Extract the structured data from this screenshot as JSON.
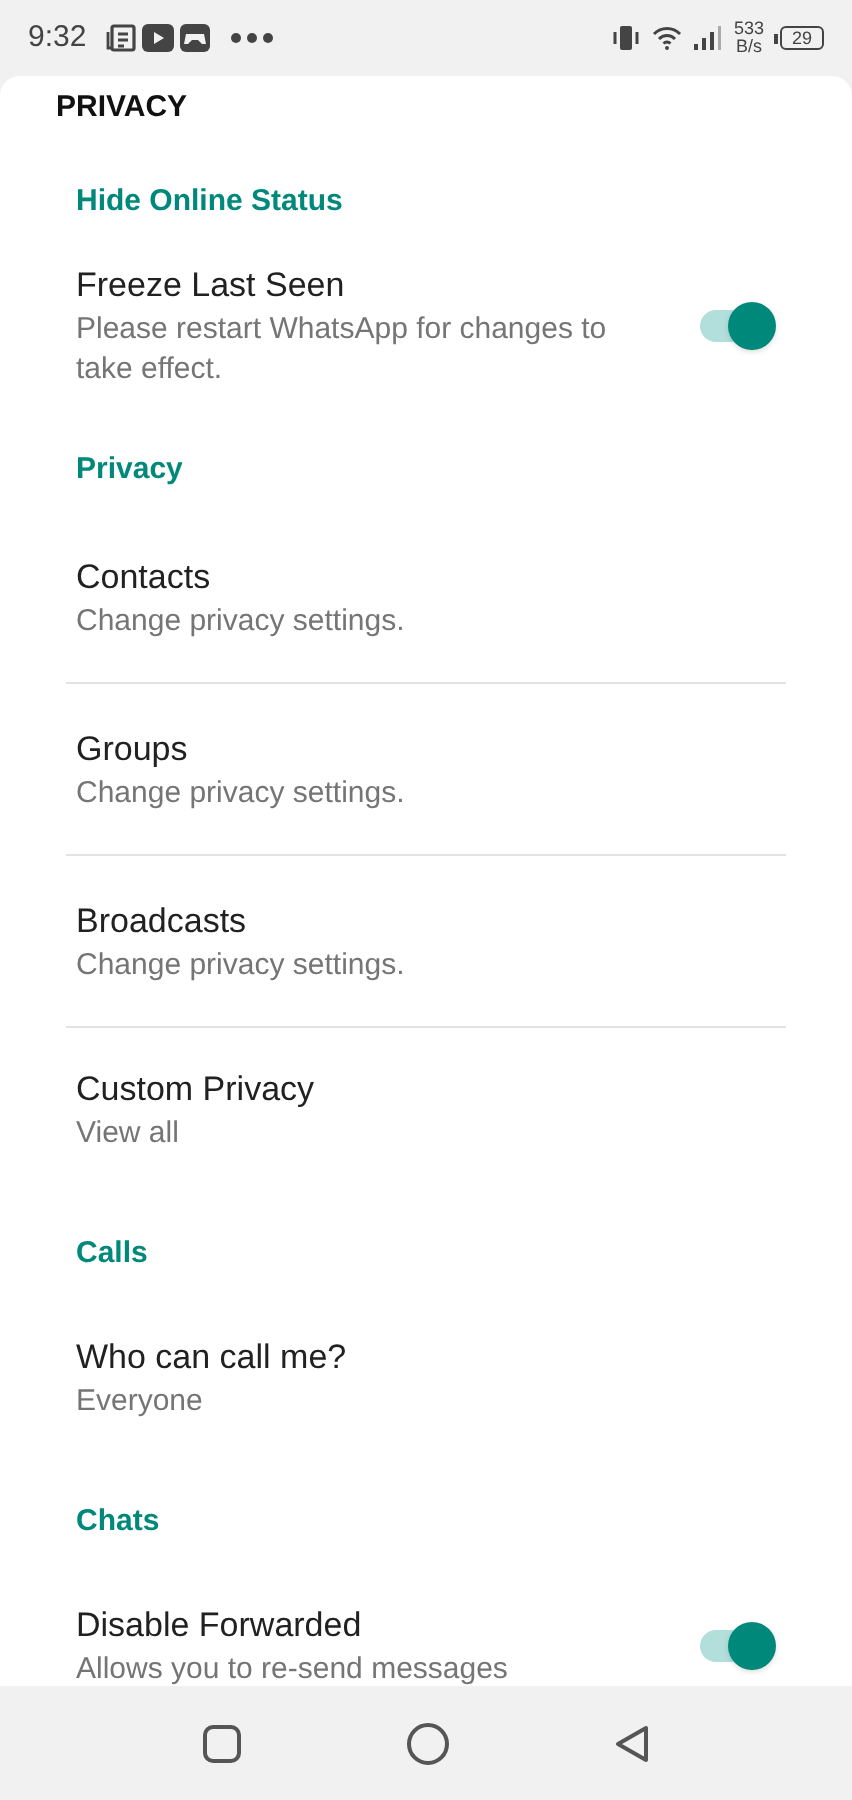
{
  "status_bar": {
    "time": "9:32",
    "speed_value": "533",
    "speed_unit": "B/s",
    "battery": "29"
  },
  "title": "PRIVACY",
  "sections": [
    {
      "title": "Hide Online Status",
      "items": [
        {
          "kind": "switch",
          "title": "Freeze Last Seen",
          "subtitle": "Please restart WhatsApp for changes to take effect.",
          "on": true
        }
      ]
    },
    {
      "title": "Privacy",
      "items": [
        {
          "kind": "item",
          "title": "Contacts",
          "subtitle": "Change privacy settings."
        },
        {
          "kind": "item",
          "title": "Groups",
          "subtitle": "Change privacy settings."
        },
        {
          "kind": "item",
          "title": "Broadcasts",
          "subtitle": "Change privacy settings."
        },
        {
          "kind": "item",
          "title": "Custom Privacy",
          "subtitle": "View all"
        }
      ]
    },
    {
      "title": "Calls",
      "items": [
        {
          "kind": "item",
          "title": "Who can call me?",
          "subtitle": "Everyone"
        }
      ]
    },
    {
      "title": "Chats",
      "items": [
        {
          "kind": "switch",
          "title": "Disable Forwarded",
          "subtitle": "Allows you to re-send messages",
          "on": true
        }
      ]
    }
  ]
}
